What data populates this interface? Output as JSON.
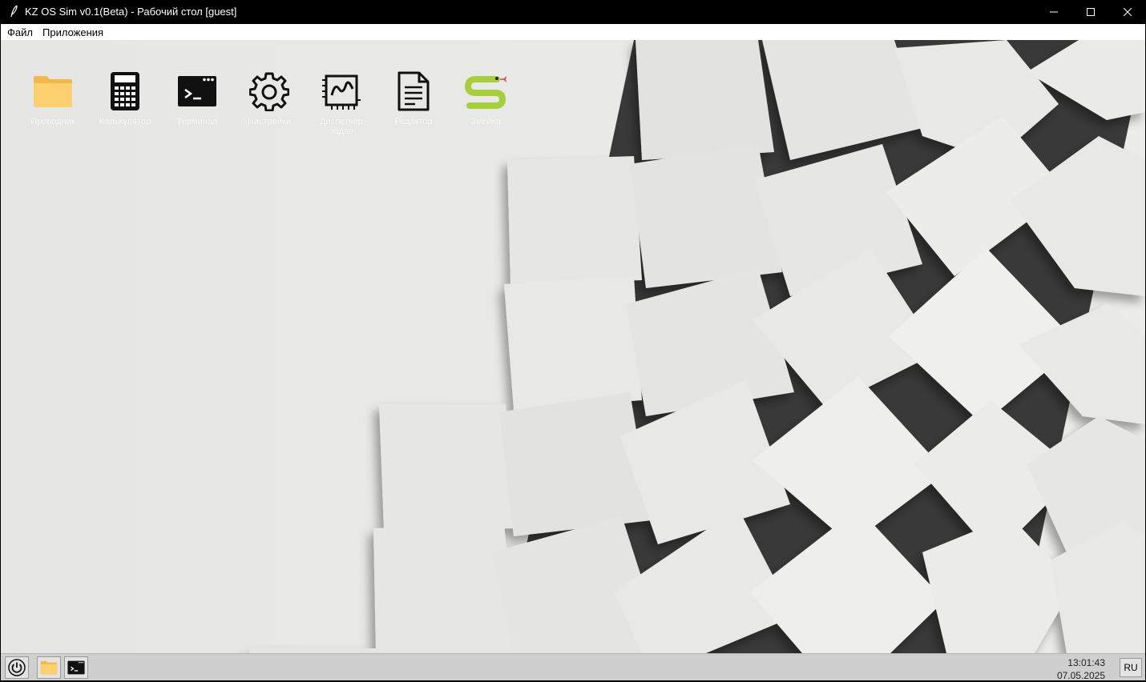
{
  "window": {
    "title": "KZ OS Sim v0.1(Beta) - Рабочий стол [guest]",
    "controls": [
      "minimize",
      "maximize",
      "close"
    ]
  },
  "menubar": {
    "items": [
      "Файл",
      "Приложения"
    ]
  },
  "desktop": {
    "icons": [
      {
        "label": "Проводник",
        "icon": "folder-icon"
      },
      {
        "label": "Калькулятор",
        "icon": "calculator-icon"
      },
      {
        "label": "Терминал",
        "icon": "terminal-icon"
      },
      {
        "label": "Настройки",
        "icon": "gear-icon"
      },
      {
        "label": "Диспетчер задач",
        "icon": "task-manager-icon"
      },
      {
        "label": "Редактор",
        "icon": "document-icon"
      },
      {
        "label": "Змейка",
        "icon": "snake-icon"
      }
    ]
  },
  "taskbar": {
    "apps": [
      "power-icon",
      "folder-icon",
      "terminal-icon"
    ],
    "time": "13:01:43",
    "date": "07.05.2025",
    "language": "RU"
  },
  "colors": {
    "titlebar": "#000000",
    "taskbar": "#cfcfcf",
    "folder": "#f8c55a",
    "snake": "#a5cf3b"
  }
}
